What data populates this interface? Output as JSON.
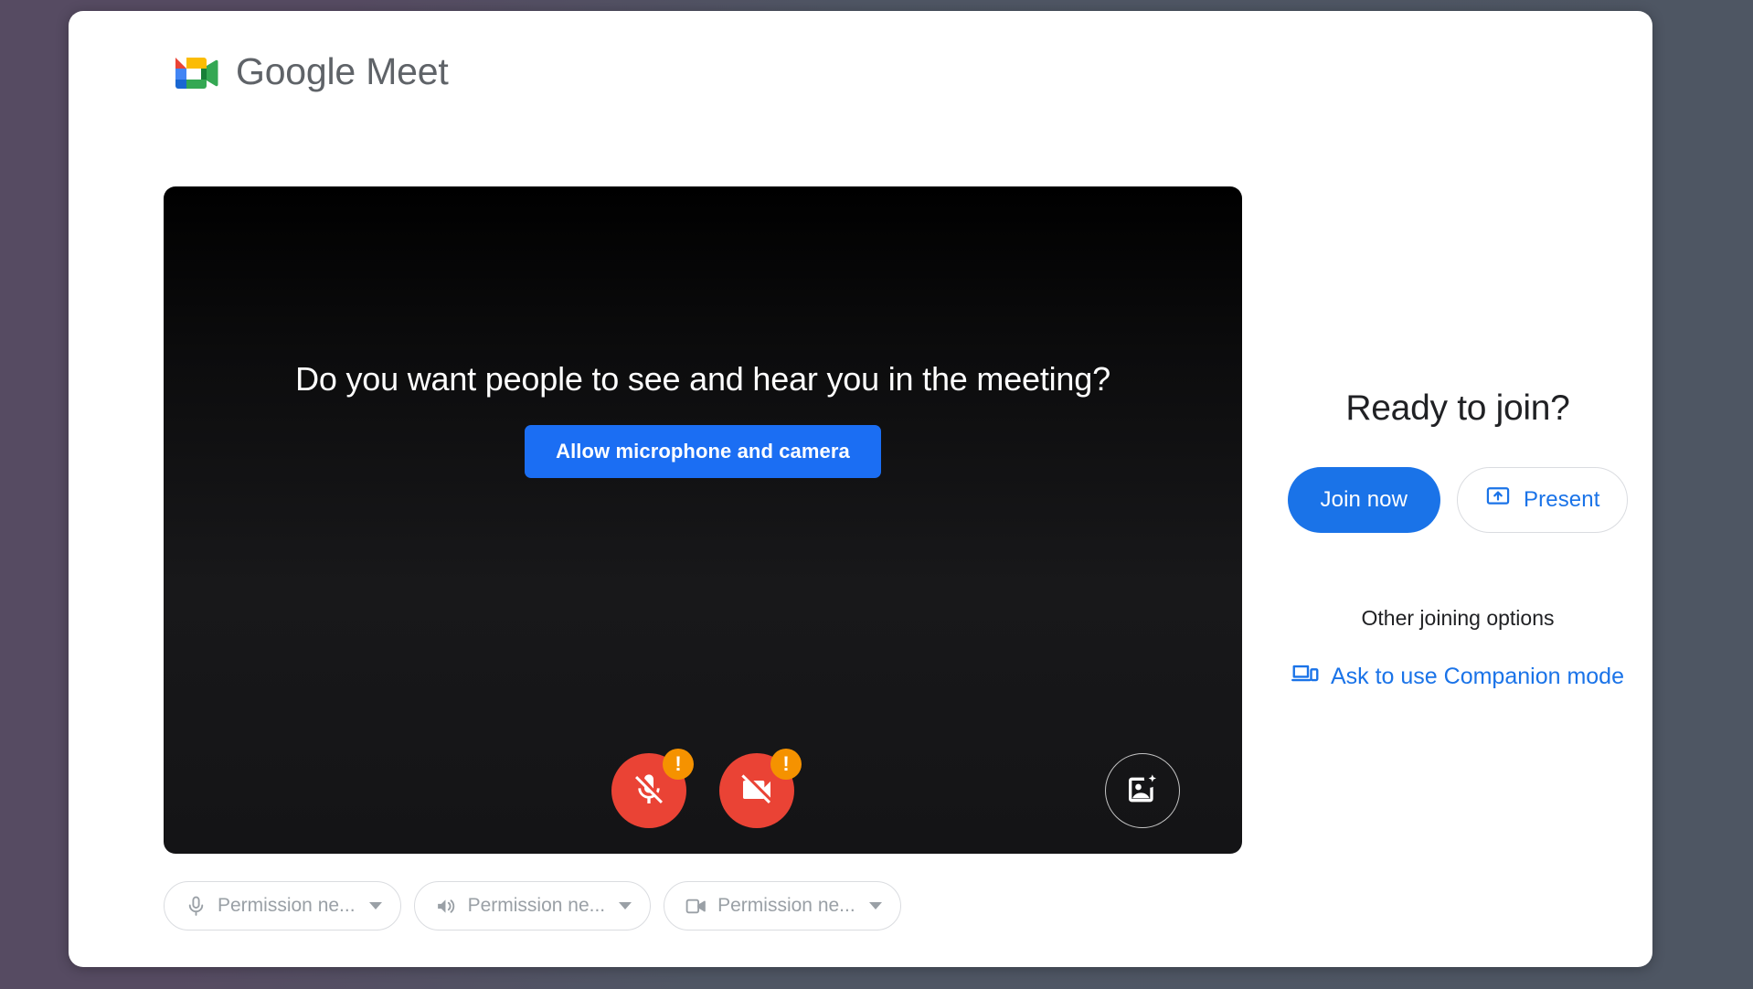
{
  "brand": {
    "logo_icon": "google-meet-logo-icon",
    "name_primary": "Google",
    "name_secondary": "Meet",
    "wordmark": "Google Meet"
  },
  "video_preview": {
    "prompt_text": "Do you want people to see and hear you in the meeting?",
    "allow_button_label": "Allow microphone and camera",
    "background_color": "#000000",
    "controls": [
      {
        "name": "microphone",
        "icon": "mic-off-icon",
        "state": "blocked",
        "color": "#ea4335",
        "badge": "!",
        "badge_color": "#f59200"
      },
      {
        "name": "camera",
        "icon": "video-off-icon",
        "state": "blocked",
        "color": "#ea4335",
        "badge": "!",
        "badge_color": "#f59200"
      }
    ],
    "effects_button": {
      "icon": "visual-effects-icon",
      "label": "Apply visual effects"
    }
  },
  "device_pills": [
    {
      "icon": "microphone-icon",
      "label": "Permission ne...",
      "caret": "chevron-down-icon"
    },
    {
      "icon": "speaker-icon",
      "label": "Permission ne...",
      "caret": "chevron-down-icon"
    },
    {
      "icon": "camera-icon",
      "label": "Permission ne...",
      "caret": "chevron-down-icon"
    }
  ],
  "join_panel": {
    "heading": "Ready to join?",
    "join_now_label": "Join now",
    "present_label": "Present",
    "present_icon": "present-screen-icon",
    "other_options_label": "Other joining options",
    "companion_mode_label": "Ask to use Companion mode",
    "companion_icon": "devices-icon"
  },
  "colors": {
    "accent_blue": "#1a73e8",
    "allow_button_blue": "#1b6ef3",
    "danger_red": "#ea4335",
    "warning_orange": "#f59200",
    "text_primary": "#202124",
    "text_muted": "#9aa0a6",
    "card_background": "#ffffff",
    "page_background_left": "#564b62",
    "page_background_right": "#4e5663"
  }
}
